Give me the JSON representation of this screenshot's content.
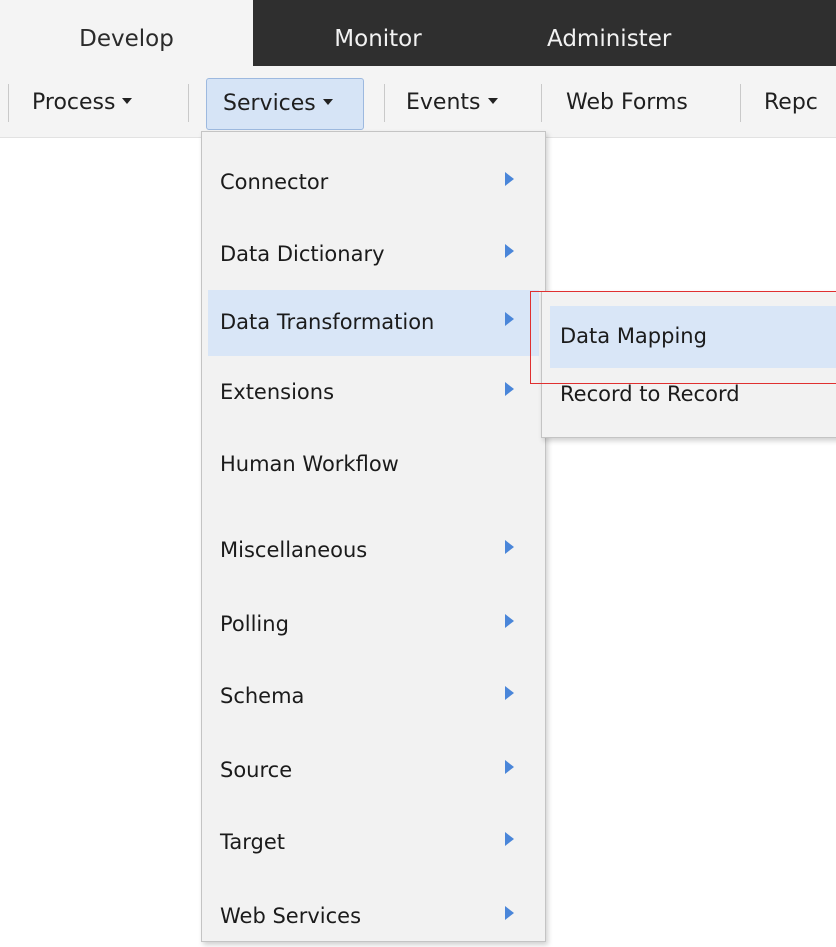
{
  "tabs": {
    "develop": "Develop",
    "monitor": "Monitor",
    "administer": "Administer"
  },
  "menubar": {
    "process": "Process",
    "services": "Services",
    "events": "Events",
    "web_forms": "Web Forms",
    "reports": "Repc"
  },
  "services_menu": {
    "items": [
      {
        "label": "Connector",
        "submenu": true
      },
      {
        "label": "Data Dictionary",
        "submenu": true
      },
      {
        "label": "Data Transformation",
        "submenu": true,
        "active": true
      },
      {
        "label": "Extensions",
        "submenu": true
      },
      {
        "label": "Human Workflow",
        "submenu": false
      },
      {
        "label": "Miscellaneous",
        "submenu": true
      },
      {
        "label": "Polling",
        "submenu": true
      },
      {
        "label": "Schema",
        "submenu": true
      },
      {
        "label": "Source",
        "submenu": true
      },
      {
        "label": "Target",
        "submenu": true
      },
      {
        "label": "Web Services",
        "submenu": true
      }
    ]
  },
  "data_transformation_submenu": {
    "items": [
      {
        "label": "Data Mapping",
        "active": true
      },
      {
        "label": "Record to Record"
      }
    ]
  },
  "colors": {
    "tab_dark": "#2f2f2f",
    "menu_bg": "#f2f2f2",
    "active_item": "#d9e6f7",
    "arrow": "#4a86d9",
    "highlight_box": "#e03030"
  }
}
